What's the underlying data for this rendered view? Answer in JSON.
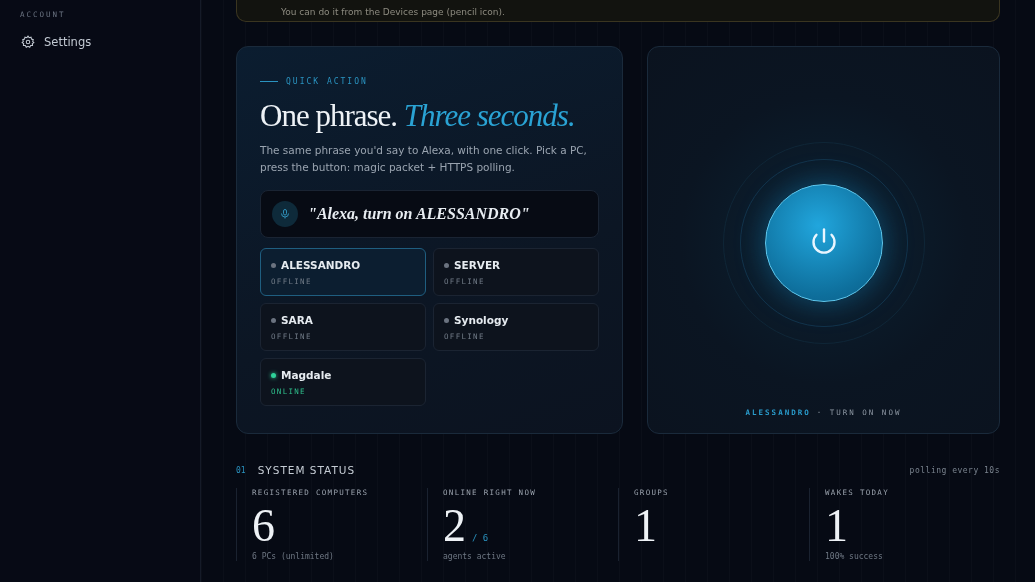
{
  "sidebar": {
    "section_label": "ACCOUNT",
    "items": [
      {
        "label": "Settings",
        "selected": false
      }
    ]
  },
  "notice": {
    "text": "You can do it from the Devices page (pencil icon)."
  },
  "quick_action": {
    "eyebrow": "QUICK ACTION",
    "title": "One phrase.",
    "title_accent": "Three seconds.",
    "description": "The same phrase you'd say to Alexa, with one click. Pick a PC, press the button: magic packet + HTTPS polling.",
    "phrase": "\"Alexa, turn on ALESSANDRO\"",
    "computers": [
      {
        "name": "ALESSANDRO",
        "status": "OFFLINE",
        "online": false,
        "selected": true
      },
      {
        "name": "SERVER",
        "status": "OFFLINE",
        "online": false,
        "selected": false
      },
      {
        "name": "SARA",
        "status": "OFFLINE",
        "online": false,
        "selected": false
      },
      {
        "name": "Synology",
        "status": "OFFLINE",
        "online": false,
        "selected": false
      },
      {
        "name": "Magdale",
        "status": "ONLINE",
        "online": true,
        "selected": false
      }
    ]
  },
  "power": {
    "target": "ALESSANDRO",
    "action": "· TURN ON NOW"
  },
  "system_status": {
    "index": "01",
    "title": "SYSTEM STATUS",
    "polling": "polling every 10s",
    "stats": [
      {
        "label": "REGISTERED COMPUTERS",
        "value": "6",
        "note": "6 PCs (unlimited)"
      },
      {
        "label": "ONLINE RIGHT NOW",
        "value": "2",
        "suffix": "/ 6",
        "note": "agents active"
      },
      {
        "label": "GROUPS",
        "value": "1"
      },
      {
        "label": "WAKES TODAY",
        "value": "1",
        "note": "100% success"
      }
    ]
  }
}
